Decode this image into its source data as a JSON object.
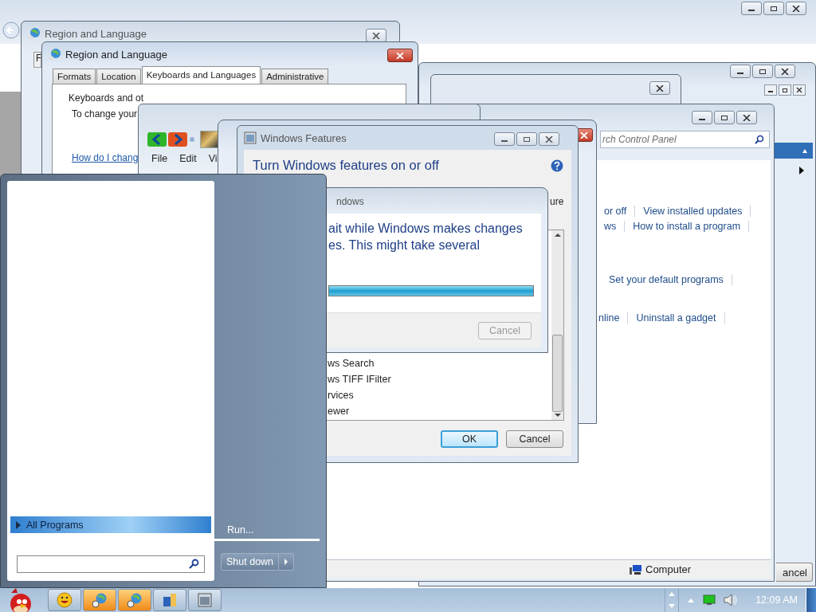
{
  "region_language_back": {
    "title": "Region and Language",
    "tab_stub": "F"
  },
  "region_language": {
    "title": "Region and Language",
    "tabs": [
      {
        "label": "Formats",
        "selected": false
      },
      {
        "label": "Location",
        "selected": false
      },
      {
        "label": "Keyboards and Languages",
        "selected": true
      },
      {
        "label": "Administrative",
        "selected": false
      }
    ],
    "group_label": "Keyboards and ot",
    "text": "To change your",
    "link": "How do I chang"
  },
  "explorer": {
    "menu": [
      "File",
      "Edit",
      "Vi"
    ]
  },
  "control_panel": {
    "search": {
      "placeholder": "rch Control Panel"
    },
    "link_rows": [
      [
        "or off",
        "View installed updates"
      ],
      [
        "ws",
        "How to install a program"
      ],
      [
        "Set your default programs"
      ],
      [
        "nline",
        "Uninstall a gadget"
      ]
    ],
    "status": "Computer"
  },
  "windows_features": {
    "title": "Windows Features",
    "heading": "Turn Windows features on or off",
    "description_tail": "ure",
    "features": [
      "ws Search",
      "ws TIFF IFilter",
      "rvices",
      "ewer"
    ],
    "buttons": [
      {
        "label": "OK",
        "default": true
      },
      {
        "label": "Cancel",
        "default": false
      }
    ]
  },
  "progress_dialog": {
    "title": "ndows",
    "message": [
      "ait while Windows makes changes",
      "es. This might take several"
    ],
    "progress": {
      "level": 1.0
    },
    "cancel": {
      "label": "Cancel",
      "disabled": true
    }
  },
  "start_menu": {
    "all_programs": "All Programs",
    "run": "Run...",
    "shutdown": "Shut down"
  },
  "right_window": {
    "button": "ancel"
  },
  "taskbar": {
    "clock": "12:09 AM"
  }
}
